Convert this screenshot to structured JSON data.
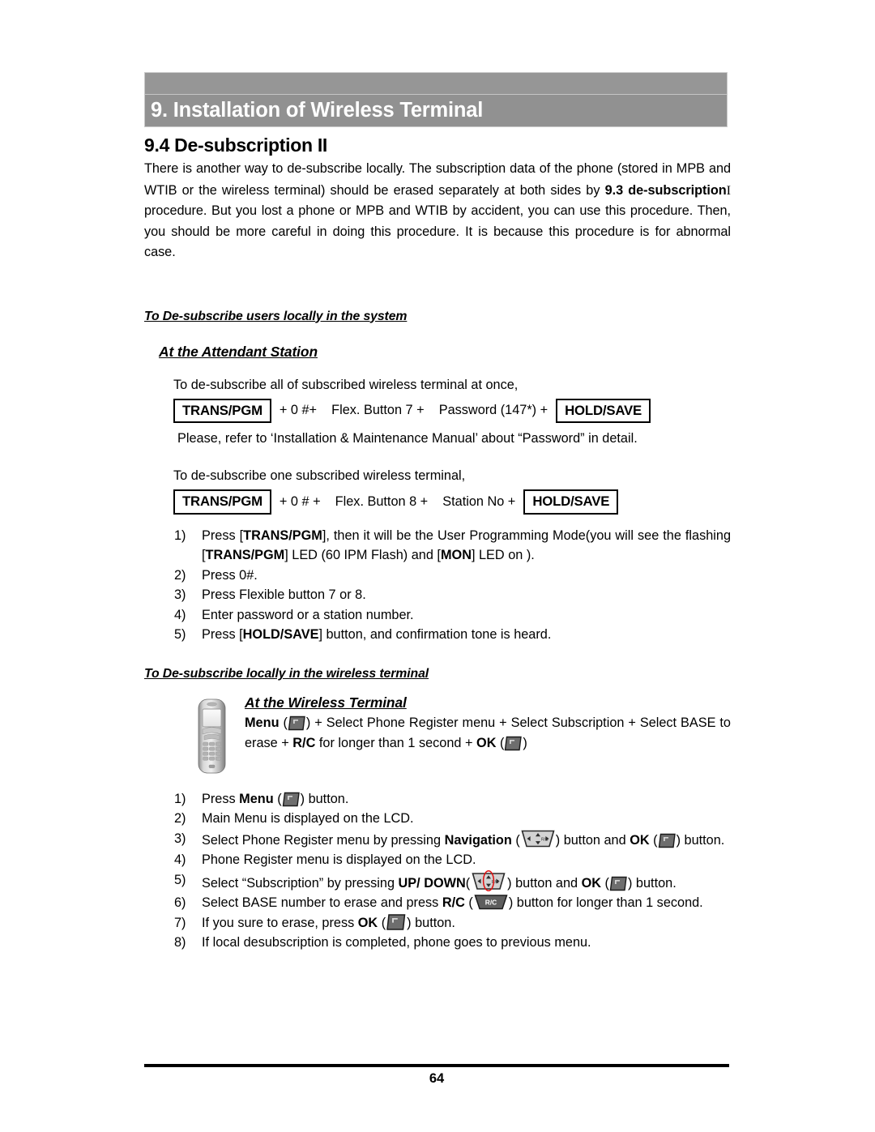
{
  "header": {
    "chapter_title": "9. Installation of Wireless Terminal"
  },
  "section": {
    "number_title": "9.4 De-subscription II",
    "intro_part1": "There is another way to de-subscribe locally. The subscription data of the phone (stored in MPB and WTIB or the wireless terminal) should be erased separately at both sides by ",
    "intro_bold1": "9.3 de-subscription",
    "intro_roman": "I",
    "intro_part2": " procedure. But you lost a phone or MPB and WTIB by accident, you can use this procedure. Then, you should be more careful in doing this procedure. It is because this procedure is for abnormal case."
  },
  "system_section": {
    "heading": "To De-subscribe users locally in the system",
    "subheading": "At the Attendant Station",
    "all_terminals_intro": "To de-subscribe all of subscribed wireless terminal at once,",
    "sequence_all": {
      "key1": "TRANS/PGM",
      "mid": "+ 0 #+    Flex. Button 7 +    Password (147*) +",
      "key2": "HOLD/SAVE"
    },
    "password_note": "Please, refer to ‘Installation & Maintenance Manual’ about “Password” in detail.",
    "one_terminal_intro": "To de-subscribe one subscribed wireless terminal,",
    "sequence_one": {
      "key1": "TRANS/PGM",
      "mid": "+ 0 # +    Flex. Button 8 +    Station No +",
      "key2": "HOLD/SAVE"
    },
    "steps": [
      {
        "num": "1)",
        "pre": "Press [",
        "b1": "TRANS/PGM",
        "mid1": "], then it will be the User Programming Mode(you will see the flashing [",
        "b2": "TRANS/PGM",
        "mid2": "] LED (60 IPM Flash) and [",
        "b3": "MON",
        "post": "] LED on )."
      },
      {
        "num": "2)",
        "text": "Press 0#."
      },
      {
        "num": "3)",
        "text": "Press Flexible button 7 or 8."
      },
      {
        "num": "4)",
        "text": "Enter password or a station number."
      },
      {
        "num": "5)",
        "pre": "Press [",
        "b1": "HOLD/SAVE",
        "post": "] button, and confirmation tone is heard."
      }
    ]
  },
  "terminal_section": {
    "heading": "To De-subscribe locally in the wireless terminal",
    "subheading": "At the Wireless Terminal",
    "sequence": {
      "menu_label": "Menu",
      "after_menu": ") + Select Phone Register menu + Select Subscription + Select BASE to erase + ",
      "rc_label": "R/C",
      "after_rc": " for longer than 1 second + ",
      "ok_label": "OK",
      "close": ")"
    },
    "steps": [
      {
        "num": "1)",
        "pre": "Press ",
        "b1": "Menu",
        "post": ") button."
      },
      {
        "num": "2)",
        "text": "Main Menu is displayed on the LCD."
      },
      {
        "num": "3)",
        "pre": "Select Phone Register menu by pressing ",
        "b1": "Navigation",
        "mid1": ") button and ",
        "b2": "OK",
        "post": ") button."
      },
      {
        "num": "4)",
        "text": "Phone Register menu is displayed on the LCD."
      },
      {
        "num": "5)",
        "pre": "Select “Subscription” by pressing ",
        "b1": "UP/ DOWN",
        "mid1": ") button and ",
        "b2": "OK",
        "post": ") button."
      },
      {
        "num": "6)",
        "pre": "Select BASE number to erase and press ",
        "b1": "R/C",
        "post": ") button for longer than 1 second."
      },
      {
        "num": "7)",
        "pre": "If you sure to erase, press ",
        "b1": "OK",
        "post": ") button."
      },
      {
        "num": "8)",
        "text": "If local desubscription is completed, phone goes to previous menu."
      }
    ]
  },
  "icons": {
    "ok_button": "ok-softkey-icon",
    "navigation_button": "navigation-pad-icon",
    "rc_button": "rc-button-icon",
    "rc_button_label": "R/C",
    "phone": "wireless-handset-image"
  },
  "footer": {
    "page_number": "64"
  },
  "colors": {
    "banner_top": "#969696",
    "banner_main": "#919191",
    "banner_text": "#ffffff",
    "body_text": "#000000",
    "highlight_oval": "#e01010"
  }
}
